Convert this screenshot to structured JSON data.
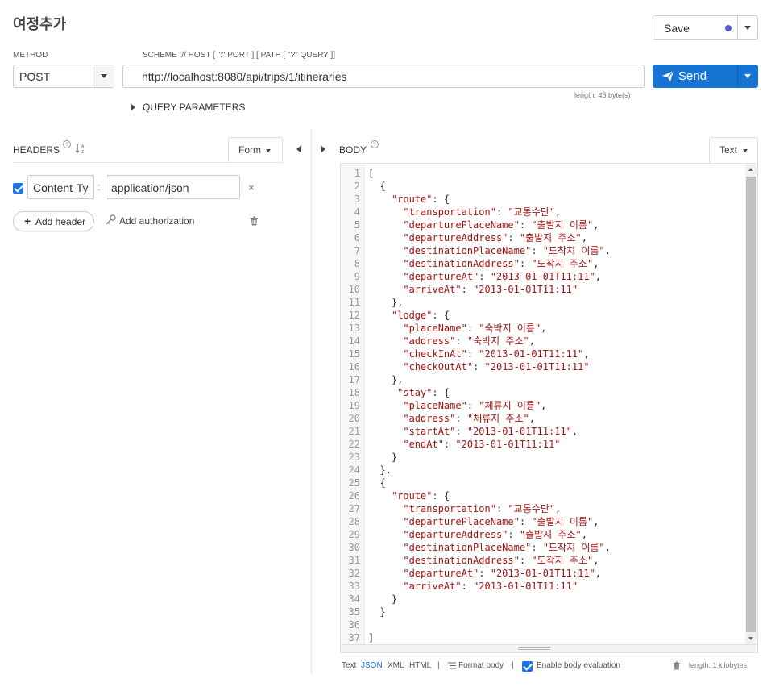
{
  "request": {
    "title": "여정추가",
    "save": {
      "label": "Save",
      "status_color": "#5b5bd6"
    },
    "method": {
      "label": "METHOD",
      "value": "POST"
    },
    "url": {
      "scheme_label": "SCHEME :// HOST [ \":\" PORT ] [ PATH [ \"?\" QUERY ]]",
      "value": "http://localhost:8080/api/trips/1/itineraries",
      "length": "length: 45 byte(s)"
    },
    "send": {
      "label": "Send",
      "color": "#1874d2"
    },
    "query_parameters": "QUERY PARAMETERS"
  },
  "headers": {
    "label": "HEADERS",
    "mode": "Form",
    "rows": [
      {
        "checked": true,
        "name": "Content-Ty",
        "value": "application/json"
      }
    ],
    "add_header": "Add header",
    "add_authorization": "Add authorization"
  },
  "body": {
    "label": "BODY",
    "mode": "Text",
    "lines": [
      "[",
      "  {",
      "    \"route\": {",
      "      \"transportation\": \"교통수단\",",
      "      \"departurePlaceName\": \"출발지 이름\",",
      "      \"departureAddress\": \"출발지 주소\",",
      "      \"destinationPlaceName\": \"도착지 이름\",",
      "      \"destinationAddress\": \"도착지 주소\",",
      "      \"departureAt\": \"2013-01-01T11:11\",",
      "      \"arriveAt\": \"2013-01-01T11:11\"",
      "    },",
      "    \"lodge\": {",
      "      \"placeName\": \"숙박지 이름\",",
      "      \"address\": \"숙박지 주소\",",
      "      \"checkInAt\": \"2013-01-01T11:11\",",
      "      \"checkOutAt\": \"2013-01-01T11:11\"",
      "    },",
      "     \"stay\": {",
      "      \"placeName\": \"체류지 이름\",",
      "      \"address\": \"체류지 주소\",",
      "      \"startAt\": \"2013-01-01T11:11\",",
      "      \"endAt\": \"2013-01-01T11:11\"",
      "    }",
      "  },",
      "  {",
      "    \"route\": {",
      "      \"transportation\": \"교통수단\",",
      "      \"departurePlaceName\": \"출발지 이름\",",
      "      \"departureAddress\": \"출발지 주소\",",
      "      \"destinationPlaceName\": \"도착지 이름\",",
      "      \"destinationAddress\": \"도착지 주소\",",
      "      \"departureAt\": \"2013-01-01T11:11\",",
      "      \"arriveAt\": \"2013-01-01T11:11\"",
      "    }",
      "  }",
      "",
      "]"
    ],
    "footer": {
      "formats": [
        "Text",
        "JSON",
        "XML",
        "HTML"
      ],
      "active_format": "JSON",
      "separator": "|",
      "format_body": "Format body",
      "enable_eval": "Enable body evaluation",
      "length": "length: 1 kilobytes"
    }
  }
}
